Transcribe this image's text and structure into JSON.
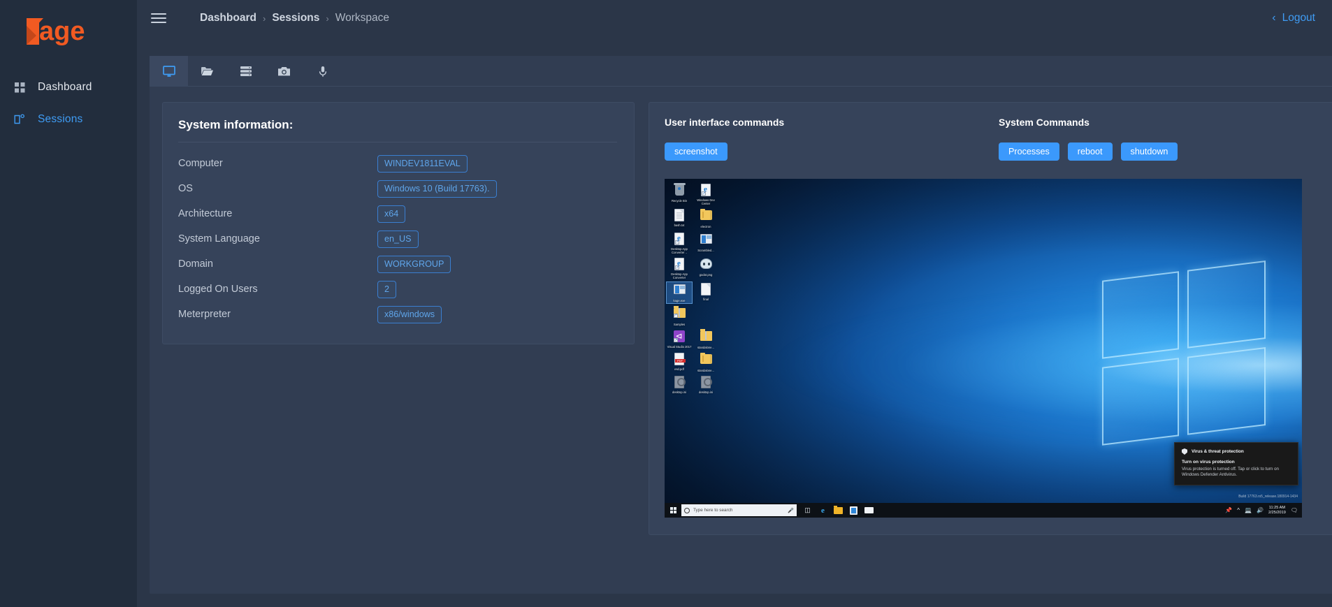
{
  "brand": {
    "name": "Kage"
  },
  "sidebar": {
    "items": [
      {
        "label": "Dashboard",
        "icon": "grid-icon",
        "active": false
      },
      {
        "label": "Sessions",
        "icon": "session-window-icon",
        "active": true
      }
    ]
  },
  "topbar": {
    "menu_icon": "hamburger-icon",
    "breadcrumb": [
      "Dashboard",
      "Sessions",
      "Workspace"
    ],
    "breadcrumb_separator": "›",
    "logout_label": "Logout",
    "logout_icon": "chevron-left-icon"
  },
  "tabs": [
    {
      "name": "desktop",
      "icon": "monitor-icon",
      "active": true
    },
    {
      "name": "files",
      "icon": "folder-icon",
      "active": false
    },
    {
      "name": "server",
      "icon": "server-icon",
      "active": false
    },
    {
      "name": "webcam",
      "icon": "camera-icon",
      "active": false
    },
    {
      "name": "microphone",
      "icon": "microphone-icon",
      "active": false
    }
  ],
  "sysinfo": {
    "title": "System information:",
    "rows": [
      {
        "key": "Computer",
        "value": "WINDEV1811EVAL"
      },
      {
        "key": "OS",
        "value": "Windows 10 (Build 17763)."
      },
      {
        "key": "Architecture",
        "value": "x64"
      },
      {
        "key": "System Language",
        "value": "en_US"
      },
      {
        "key": "Domain",
        "value": "WORKGROUP"
      },
      {
        "key": "Logged On Users",
        "value": "2"
      },
      {
        "key": "Meterpreter",
        "value": "x86/windows"
      }
    ]
  },
  "commands": {
    "ui_title": "User interface commands",
    "ui_buttons": [
      {
        "label": "screenshot"
      }
    ],
    "system_title": "System Commands",
    "system_buttons": [
      {
        "label": "Processes"
      },
      {
        "label": "reboot"
      },
      {
        "label": "shutdown"
      }
    ]
  },
  "screenshot": {
    "desktop_icons": [
      {
        "label": "Recycle Bin",
        "icon": "recycle-bin-icon",
        "selected": false
      },
      {
        "label": "Windows Dev Center",
        "icon": "edge-shortcut-icon",
        "selected": false
      },
      {
        "label": "bash.txt",
        "icon": "text-file-icon",
        "selected": false
      },
      {
        "label": "electron",
        "icon": "folder-icon",
        "selected": false
      },
      {
        "label": "Desktop App Converter ..",
        "icon": "edge-shortcut-icon",
        "selected": false
      },
      {
        "label": "Scrambled...",
        "icon": "application-icon",
        "selected": false
      },
      {
        "label": "Desktop App Converter",
        "icon": "edge-shortcut-icon",
        "selected": false
      },
      {
        "label": "godot.png",
        "icon": "godot-image-icon",
        "selected": false
      },
      {
        "label": "kage.exe",
        "icon": "application-icon",
        "selected": true
      },
      {
        "label": "final",
        "icon": "blank-file-icon",
        "selected": false
      },
      {
        "label": "Samples",
        "icon": "folder-shortcut-icon",
        "selected": false
      },
      {
        "label": "",
        "icon": "empty-icon",
        "selected": false
      },
      {
        "label": "Visual Studio 2017",
        "icon": "visual-studio-icon",
        "selected": false
      },
      {
        "label": "standalone...",
        "icon": "zip-folder-icon",
        "selected": false
      },
      {
        "label": "esd.pdf",
        "icon": "pdf-file-icon",
        "selected": false
      },
      {
        "label": "standalone...",
        "icon": "folder-icon",
        "selected": false
      },
      {
        "label": "desktop.ini",
        "icon": "ini-file-icon",
        "selected": false
      },
      {
        "label": "desktop.ini",
        "icon": "ini-file-icon",
        "selected": false
      }
    ],
    "taskbar": {
      "start_icon": "windows-start-icon",
      "search_placeholder": "Type here to search",
      "search_icon": "search-circle-icon",
      "mic_icon": "microphone-icon",
      "pinned": [
        {
          "name": "task-view",
          "icon": "task-view-icon"
        },
        {
          "name": "edge",
          "icon": "edge-icon"
        },
        {
          "name": "file-explorer",
          "icon": "file-explorer-icon"
        },
        {
          "name": "microsoft-store",
          "icon": "store-icon"
        },
        {
          "name": "mail",
          "icon": "mail-icon"
        }
      ],
      "tray": [
        "pin-icon",
        "chevron-up-icon",
        "network-icon",
        "volume-icon"
      ],
      "clock_time": "11:25 AM",
      "clock_date": "2/25/2019",
      "action_center_icon": "action-center-icon"
    },
    "watermark": "Build 17763.rs5_release.180914-1434",
    "toast": {
      "app": "Virus & threat protection",
      "app_icon": "shield-icon",
      "title": "Turn on virus protection",
      "body": "Virus protection is turned off. Tap or click to turn on Windows Defender Antivirus."
    }
  },
  "colors": {
    "sidebar_bg": "#222d3d",
    "page_bg": "#2b3648",
    "card_bg": "#313d52",
    "panel_bg": "#36435a",
    "accent_blue": "#3b99fc",
    "link_blue": "#3f9cf4",
    "brand_orange": "#f15a22"
  }
}
